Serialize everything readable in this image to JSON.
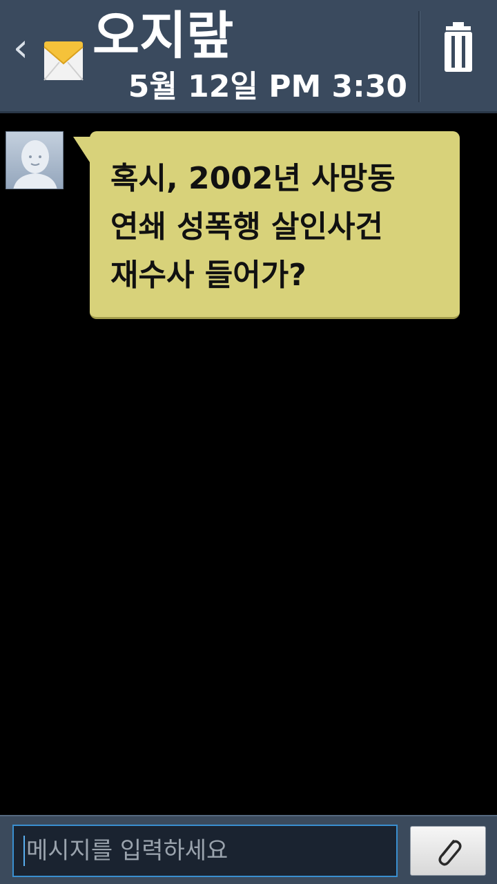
{
  "header": {
    "back_glyph": "‹",
    "contact_name": "오지랖",
    "date": "5월 12일 PM 3:30",
    "icons": {
      "back": "back-chevron-icon",
      "message": "envelope-icon",
      "delete": "trash-icon"
    }
  },
  "messages": [
    {
      "direction": "incoming",
      "text": "혹시, 2002년 사망동\n연쇄 성폭행 살인사건\n재수사 들어가?",
      "avatar_icon": "default-avatar-icon"
    }
  ],
  "composer": {
    "placeholder": "메시지를 입력하세요",
    "attach_icon": "paperclip-icon"
  },
  "colors": {
    "header_bg": "#3a4a5e",
    "bubble_bg": "#d8d27a",
    "screen_bg": "#000000",
    "input_border": "#3a8fd0"
  }
}
